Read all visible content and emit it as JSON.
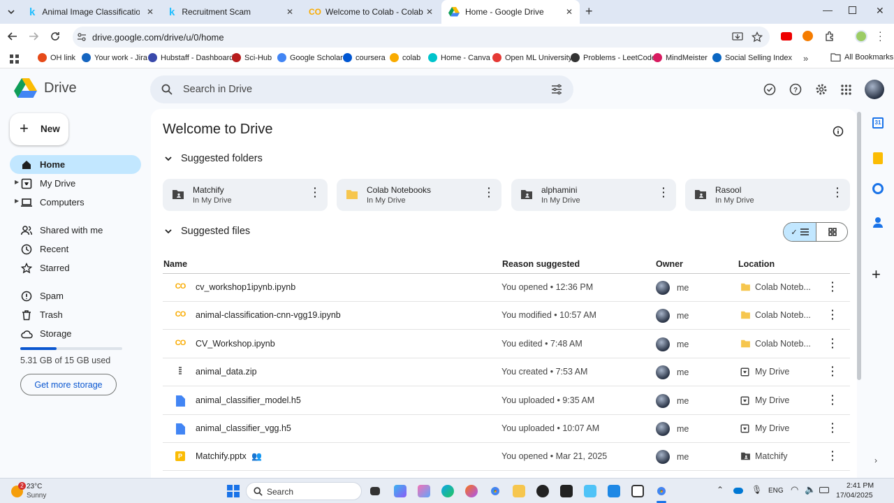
{
  "tabs": [
    {
      "title": "Animal Image Classification Datas",
      "icon": "kaggle-icon"
    },
    {
      "title": "Recruitment Scam",
      "icon": "kaggle-icon"
    },
    {
      "title": "Welcome to Colab - Colab",
      "icon": "colab-icon"
    },
    {
      "title": "Home - Google Drive",
      "icon": "drive-icon"
    }
  ],
  "url": "drive.google.com/drive/u/0/home",
  "bookmarks": [
    {
      "label": "OH link",
      "color": "#e64a19"
    },
    {
      "label": "Your work - Jira",
      "color": "#1565c0"
    },
    {
      "label": "Hubstaff - Dashboard",
      "color": "#3949ab"
    },
    {
      "label": "Sci-Hub",
      "color": "#b71c1c"
    },
    {
      "label": "Google Scholar",
      "color": "#4285f4"
    },
    {
      "label": "coursera",
      "color": "#0056d2"
    },
    {
      "label": "colab",
      "color": "#f9ab00"
    },
    {
      "label": "Home - Canva",
      "color": "#00c4cc"
    },
    {
      "label": "Open ML University",
      "color": "#e53935"
    },
    {
      "label": "Problems - LeetCode",
      "color": "#333333"
    },
    {
      "label": "MindMeister",
      "color": "#d81b60"
    },
    {
      "label": "Social Selling Index",
      "color": "#0a66c2"
    }
  ],
  "all_bookmarks": "All Bookmarks",
  "drive": {
    "logo_text": "Drive",
    "search_placeholder": "Search in Drive",
    "new_label": "New",
    "nav": [
      {
        "label": "Home",
        "icon": "home-icon"
      },
      {
        "label": "My Drive",
        "icon": "my-drive-icon"
      },
      {
        "label": "Computers",
        "icon": "computer-icon"
      },
      {
        "label": "Shared with me",
        "icon": "shared-icon"
      },
      {
        "label": "Recent",
        "icon": "clock-icon"
      },
      {
        "label": "Starred",
        "icon": "star-icon"
      },
      {
        "label": "Spam",
        "icon": "spam-icon"
      },
      {
        "label": "Trash",
        "icon": "trash-icon"
      },
      {
        "label": "Storage",
        "icon": "cloud-icon"
      }
    ],
    "storage_text": "5.31 GB of 15 GB used",
    "storage_fraction": 0.354,
    "get_storage": "Get more storage",
    "welcome": "Welcome to Drive",
    "suggested_folders_label": "Suggested folders",
    "folders": [
      {
        "name": "Matchify",
        "sub": "In My Drive",
        "shared": true
      },
      {
        "name": "Colab Notebooks",
        "sub": "In My Drive",
        "shared": false
      },
      {
        "name": "alphamini",
        "sub": "In My Drive",
        "shared": true
      },
      {
        "name": "Rasool",
        "sub": "In My Drive",
        "shared": true
      }
    ],
    "suggested_files_label": "Suggested files",
    "columns": {
      "name": "Name",
      "reason": "Reason suggested",
      "owner": "Owner",
      "location": "Location"
    },
    "files": [
      {
        "name": "cv_workshop1ipynb.ipynb",
        "type": "colab",
        "reason": "You opened • 12:36 PM",
        "owner": "me",
        "location": "Colab Noteb...",
        "loc_type": "folder"
      },
      {
        "name": "animal-classification-cnn-vgg19.ipynb",
        "type": "colab",
        "reason": "You modified • 10:57 AM",
        "owner": "me",
        "location": "Colab Noteb...",
        "loc_type": "folder"
      },
      {
        "name": "CV_Workshop.ipynb",
        "type": "colab",
        "reason": "You edited • 7:48 AM",
        "owner": "me",
        "location": "Colab Noteb...",
        "loc_type": "folder"
      },
      {
        "name": "animal_data.zip",
        "type": "zip",
        "reason": "You created • 7:53 AM",
        "owner": "me",
        "location": "My Drive",
        "loc_type": "drive"
      },
      {
        "name": "animal_classifier_model.h5",
        "type": "doc",
        "reason": "You uploaded • 9:35 AM",
        "owner": "me",
        "location": "My Drive",
        "loc_type": "drive"
      },
      {
        "name": "animal_classifier_vgg.h5",
        "type": "doc",
        "reason": "You uploaded • 10:07 AM",
        "owner": "me",
        "location": "My Drive",
        "loc_type": "drive"
      },
      {
        "name": "Matchify.pptx",
        "type": "slides",
        "reason": "You opened • Mar 21, 2025",
        "owner": "me",
        "location": "Matchify",
        "loc_type": "shared-folder",
        "shared": true
      }
    ]
  },
  "taskbar": {
    "temp": "23°C",
    "weather": "Sunny",
    "weather_badge": "2",
    "search": "Search",
    "lang": "ENG",
    "time": "2:41 PM",
    "date": "17/04/2025"
  }
}
